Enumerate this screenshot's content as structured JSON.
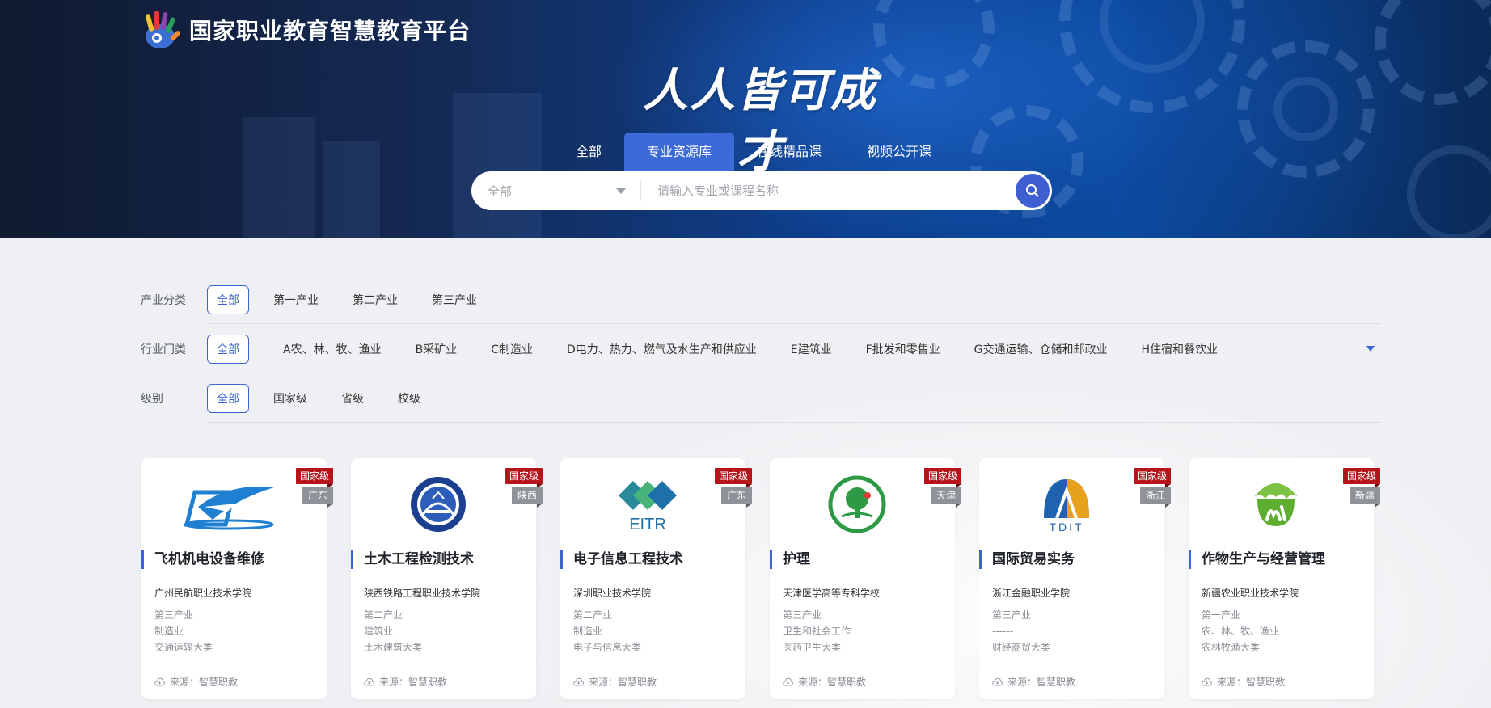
{
  "header": {
    "site_title": "国家职业教育智慧教育平台",
    "slogan": "人人皆可成才",
    "tabs": [
      {
        "label": "全部",
        "active": false
      },
      {
        "label": "专业资源库",
        "active": true
      },
      {
        "label": "在线精品课",
        "active": false
      },
      {
        "label": "视频公开课",
        "active": false
      }
    ],
    "search": {
      "scope_value": "全部",
      "placeholder": "请输入专业或课程名称"
    }
  },
  "filters": {
    "industry_category": {
      "label": "产业分类",
      "options": [
        "全部",
        "第一产业",
        "第二产业",
        "第三产业"
      ],
      "selected": "全部"
    },
    "sector": {
      "label": "行业门类",
      "options": [
        "全部",
        "A农、林、牧、渔业",
        "B采矿业",
        "C制造业",
        "D电力、热力、燃气及水生产和供应业",
        "E建筑业",
        "F批发和零售业",
        "G交通运输、仓储和邮政业",
        "H住宿和餐饮业"
      ],
      "selected": "全部"
    },
    "level": {
      "label": "级别",
      "options": [
        "全部",
        "国家级",
        "省级",
        "校级"
      ],
      "selected": "全部"
    }
  },
  "cards": [
    {
      "title": "飞机机电设备维修",
      "level": "国家级",
      "region": "广东",
      "school": "广州民航职业技术学院",
      "industry": "第三产业",
      "sector": "制造业",
      "category": "交通运输大类",
      "source": "来源：智慧职教"
    },
    {
      "title": "土木工程检测技术",
      "level": "国家级",
      "region": "陕西",
      "school": "陕西铁路工程职业技术学院",
      "industry": "第二产业",
      "sector": "建筑业",
      "category": "土木建筑大类",
      "source": "来源：智慧职教"
    },
    {
      "title": "电子信息工程技术",
      "level": "国家级",
      "region": "广东",
      "school": "深圳职业技术学院",
      "industry": "第二产业",
      "sector": "制造业",
      "category": "电子与信息大类",
      "source": "来源：智慧职教"
    },
    {
      "title": "护理",
      "level": "国家级",
      "region": "天津",
      "school": "天津医学高等专科学校",
      "industry": "第三产业",
      "sector": "卫生和社会工作",
      "category": "医药卫生大类",
      "source": "来源：智慧职教"
    },
    {
      "title": "国际贸易实务",
      "level": "国家级",
      "region": "浙江",
      "school": "浙江金融职业学院",
      "industry": "第三产业",
      "sector": "------",
      "category": "财经商贸大类",
      "source": "来源：智慧职教"
    },
    {
      "title": "作物生产与经营管理",
      "level": "国家级",
      "region": "新疆",
      "school": "新疆农业职业技术学院",
      "industry": "第一产业",
      "sector": "农、林、牧、渔业",
      "category": "农林牧渔大类",
      "source": "来源：智慧职教"
    }
  ],
  "logos": {
    "card0": "plane-logo",
    "card1": "railway-college-seal",
    "card2": "EITR",
    "card3": "tree-hands-emblem",
    "card4": "TDIT",
    "card5": "green-plant-logo"
  },
  "colors": {
    "primary": "#3c64d0",
    "badge_level": "#b5141b",
    "badge_region": "#8f9299"
  }
}
